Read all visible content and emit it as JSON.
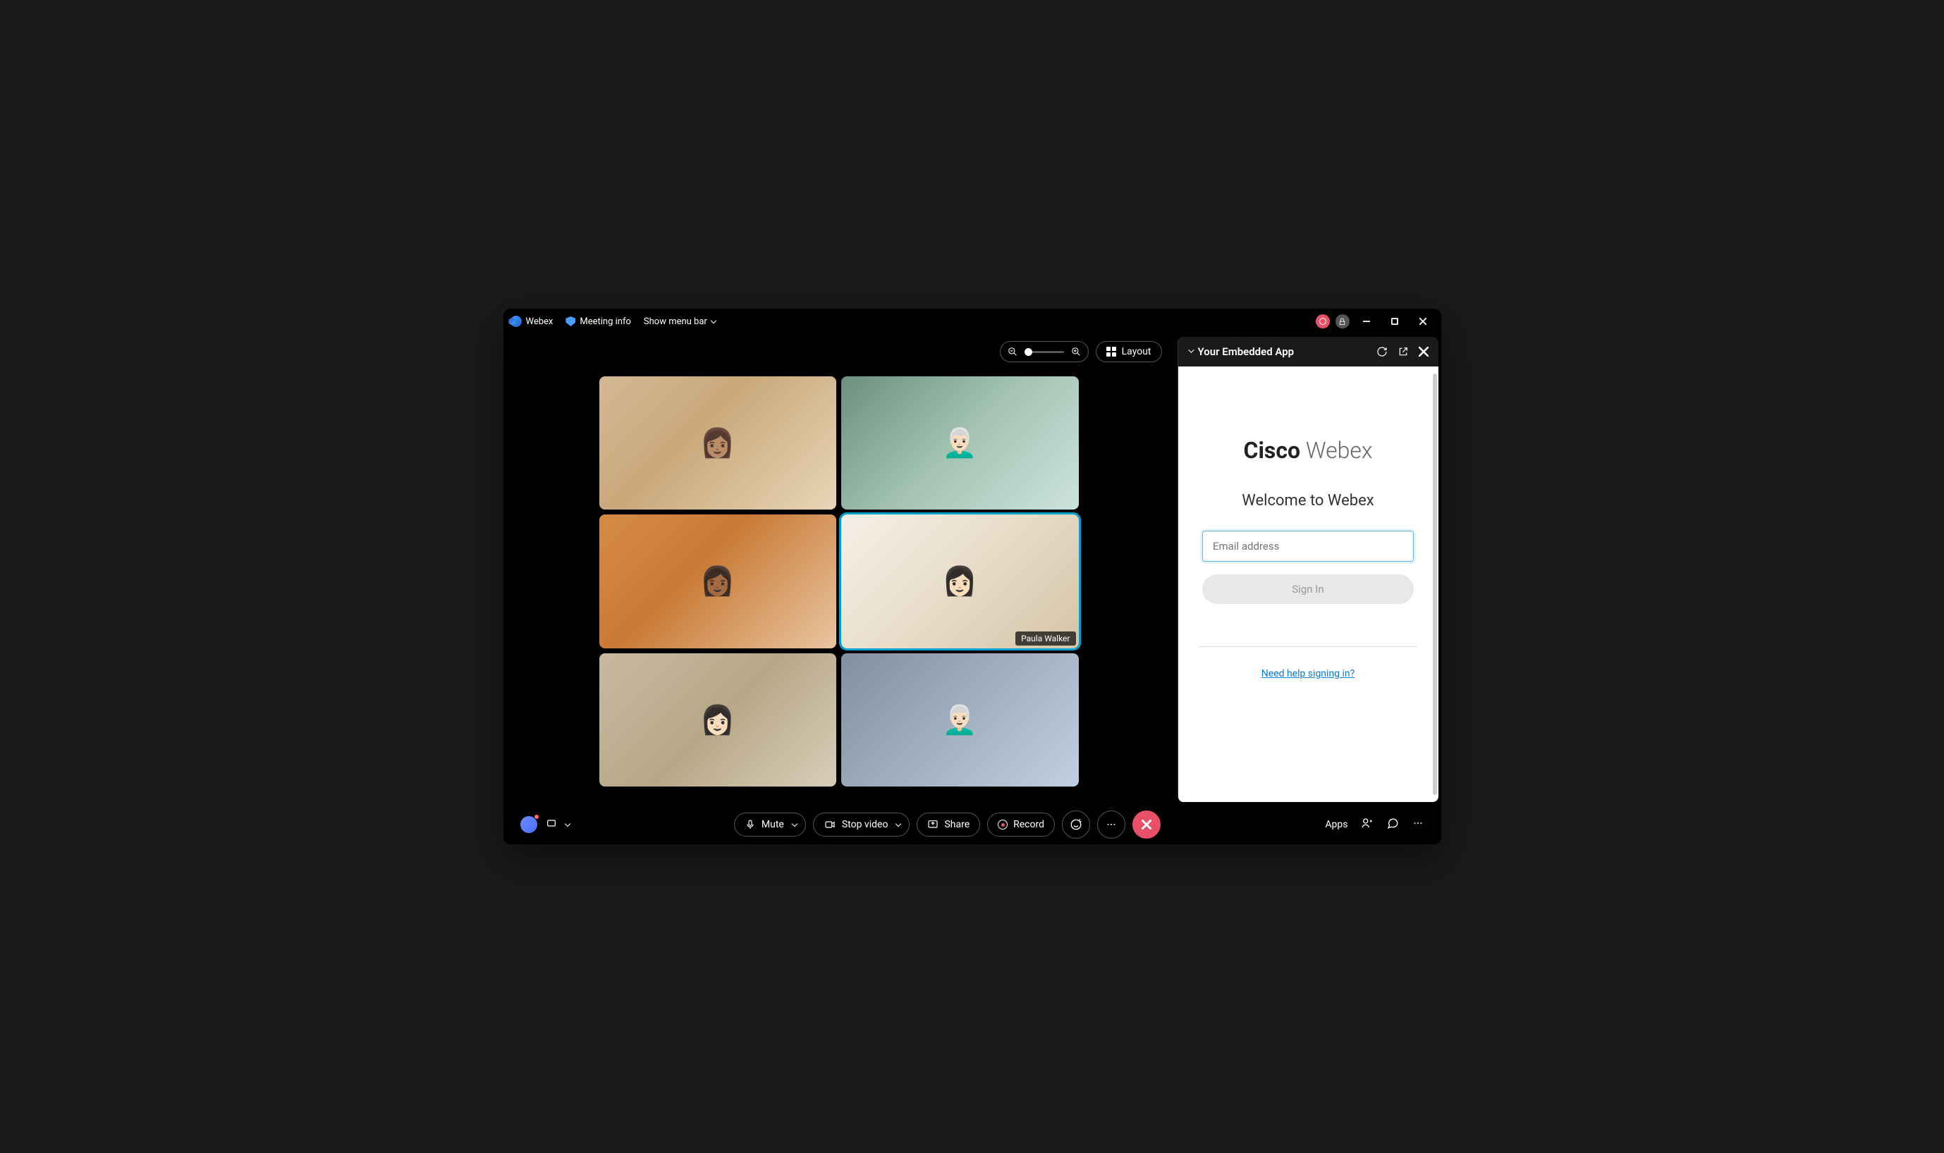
{
  "titlebar": {
    "app_name": "Webex",
    "meeting_info": "Meeting info",
    "show_menu": "Show menu bar"
  },
  "top_controls": {
    "layout": "Layout"
  },
  "participants": [
    {
      "name": ""
    },
    {
      "name": ""
    },
    {
      "name": ""
    },
    {
      "name": "Paula Walker",
      "active": true
    },
    {
      "name": ""
    },
    {
      "name": ""
    }
  ],
  "controls": {
    "mute": "Mute",
    "stop_video": "Stop video",
    "share": "Share",
    "record": "Record",
    "apps": "Apps"
  },
  "sidebar": {
    "title": "Your Embedded App",
    "brand_bold": "Cisco",
    "brand_light": " Webex",
    "welcome": "Welcome to Webex",
    "email_placeholder": "Email address",
    "signin": "Sign In",
    "help": "Need help signing in?"
  }
}
